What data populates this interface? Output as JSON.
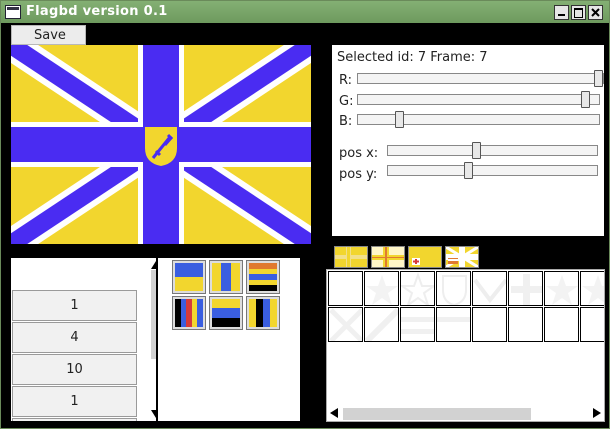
{
  "window": {
    "title": "Flagbd version 0.1",
    "titlebar_color": "#76a266"
  },
  "menu": {
    "save_label": "Save"
  },
  "flag": {
    "field_color": "#f2d62e",
    "cross_color": "#4a2cf2",
    "fimbriation_color": "#ffffff",
    "emblem": "sword-shield-icon"
  },
  "properties": {
    "selected_text": "Selected id: 7 Frame: 7",
    "r_label": "R:",
    "g_label": "G:",
    "b_label": "B:",
    "pos_x_label": "pos  x:",
    "pos_y_label": "pos  y:",
    "r_value": 1.0,
    "g_value": 0.96,
    "b_value": 0.16,
    "pos_x_value": 0.42,
    "pos_y_value": 0.38
  },
  "list": {
    "items": [
      "1",
      "4",
      "10",
      "1"
    ]
  },
  "layouts": [
    "two-horizontal-bands-icon",
    "three-vertical-bands-icon",
    "five-horizontal-stripes-icon",
    "vertical-stripes-icon",
    "three-horizontal-bands-icon",
    "four-vertical-bands-icon"
  ],
  "emblem_tabs": [
    "cross-tab-icon",
    "fimbriated-cross-tab-icon",
    "small-emblem-tab-icon",
    "flag-thumbnail-tab-icon"
  ],
  "emblem_grid": {
    "row1": [
      "blank-cell",
      "star-icon",
      "star-outline-icon",
      "shield-icon",
      "chevron-icon",
      "cross-icon",
      "star-icon",
      "star-icon"
    ],
    "row2": [
      "saltire-icon",
      "diagonal-icon",
      "stripes-icon",
      "blank-cell",
      "blank-cell",
      "blank-cell",
      "blank-cell",
      "blank-cell"
    ]
  }
}
